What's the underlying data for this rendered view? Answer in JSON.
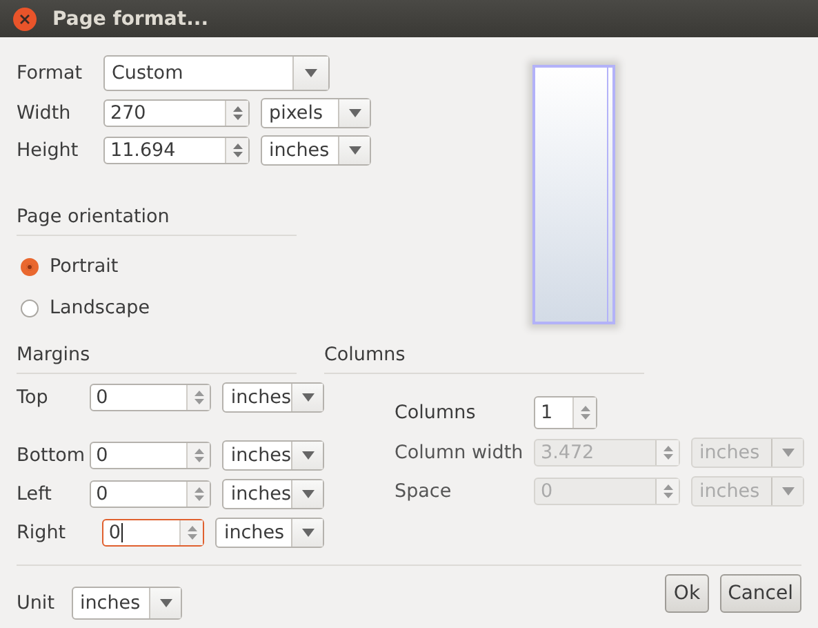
{
  "window": {
    "title": "Page format..."
  },
  "format": {
    "label": "Format",
    "value": "Custom"
  },
  "size_fields": [
    {
      "label": "Width",
      "value": "270",
      "unit": "pixels"
    },
    {
      "label": "Height",
      "value": "11.694",
      "unit": "inches"
    }
  ],
  "orientation": {
    "heading": "Page orientation",
    "options": [
      {
        "label": "Portrait",
        "selected": true
      },
      {
        "label": "Landscape",
        "selected": false
      }
    ]
  },
  "margins": {
    "heading": "Margins",
    "fields": [
      {
        "label": "Top",
        "value": "0",
        "unit": "inches",
        "focused": false
      },
      {
        "label": "Bottom",
        "value": "0",
        "unit": "inches",
        "focused": false
      },
      {
        "label": "Left",
        "value": "0",
        "unit": "inches",
        "focused": false
      },
      {
        "label": "Right",
        "value": "0",
        "unit": "inches",
        "focused": true
      }
    ]
  },
  "columns": {
    "heading": "Columns",
    "fields": [
      {
        "label": "Columns",
        "value": "1",
        "disabled": false
      },
      {
        "label": "Column width",
        "value": "3.472",
        "unit": "inches",
        "disabled": true
      },
      {
        "label": "Space",
        "value": "0",
        "unit": "inches",
        "disabled": true
      }
    ]
  },
  "unit": {
    "label": "Unit",
    "value": "inches"
  },
  "buttons": [
    "Ok",
    "Cancel"
  ]
}
